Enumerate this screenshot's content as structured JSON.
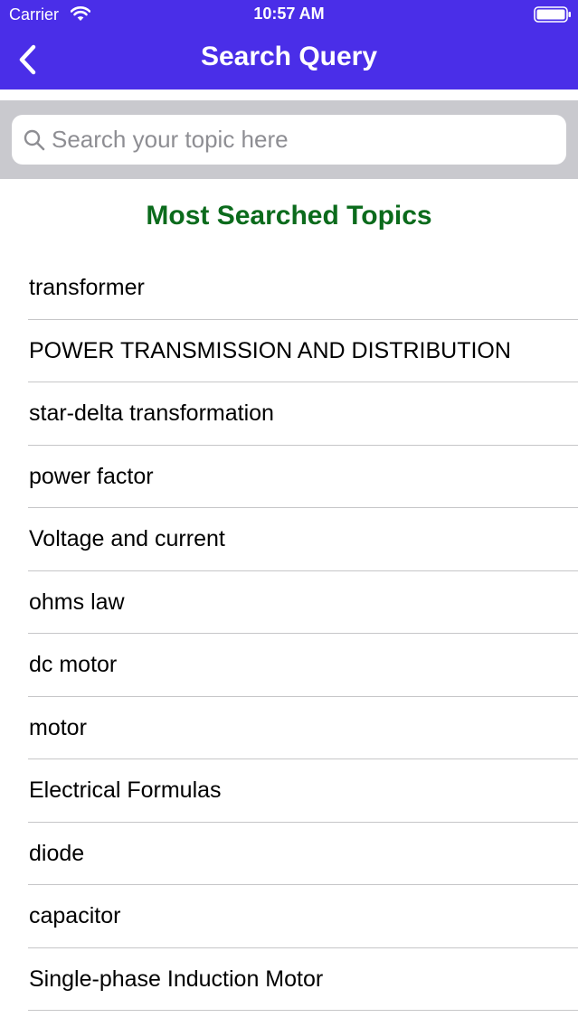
{
  "status_bar": {
    "carrier": "Carrier",
    "time": "10:57 AM",
    "wifi_icon": "wifi-icon",
    "battery_icon": "battery-icon"
  },
  "nav_bar": {
    "title": "Search Query",
    "back_icon": "chevron-left-icon"
  },
  "search": {
    "placeholder": "Search your topic here",
    "value": "",
    "icon": "search-icon"
  },
  "section": {
    "title": "Most Searched Topics"
  },
  "topics": [
    {
      "label": "transformer"
    },
    {
      "label": "POWER TRANSMISSION AND DISTRIBUTION"
    },
    {
      "label": "star-delta transformation"
    },
    {
      "label": "power factor"
    },
    {
      "label": "Voltage and current"
    },
    {
      "label": "ohms law"
    },
    {
      "label": "dc motor"
    },
    {
      "label": "motor"
    },
    {
      "label": "Electrical Formulas"
    },
    {
      "label": "diode"
    },
    {
      "label": "capacitor"
    },
    {
      "label": "Single-phase Induction Motor"
    }
  ],
  "colors": {
    "accent": "#4a2ee8",
    "section_title": "#0b6b1c",
    "search_background": "#c9c9ce",
    "separator": "#c6c6c8"
  }
}
